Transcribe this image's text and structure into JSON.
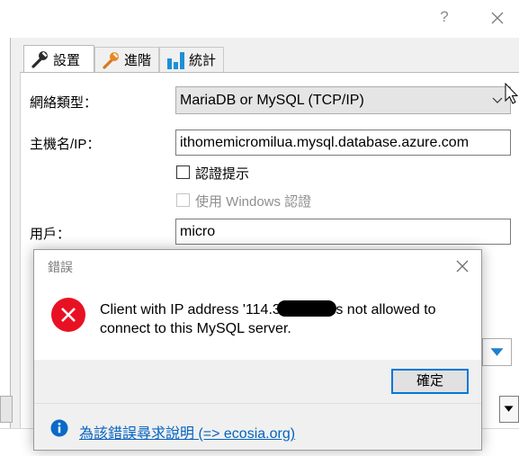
{
  "window": {
    "help_glyph": "?",
    "tabs": [
      {
        "label": "設置",
        "icon": "wrench-icon"
      },
      {
        "label": "進階",
        "icon": "wrench-orange-icon"
      },
      {
        "label": "統計",
        "icon": "bar-chart-icon"
      }
    ]
  },
  "settings": {
    "network_type_label": "網絡類型：",
    "network_type_value": "MariaDB or MySQL (TCP/IP)",
    "hostname_label": "主機名/IP：",
    "hostname_value": "ithomemicromilua.mysql.database.azure.com",
    "auth_prompt_label": "認證提示",
    "auth_prompt_checked": false,
    "windows_auth_label": "使用 Windows 認證",
    "windows_auth_checked": false,
    "user_label": "用戶：",
    "user_value": "micro"
  },
  "dialog": {
    "title": "錯誤",
    "message_part1": "Client with IP address '114.3",
    "message_part2": "is not allowed to connect to this MySQL server.",
    "ok_label": "確定",
    "help_link": "為該錯誤尋求說明 (=> ecosia.org)"
  },
  "colors": {
    "error_red": "#e81123",
    "accent_blue": "#0078d7",
    "link_blue": "#0563c1"
  }
}
